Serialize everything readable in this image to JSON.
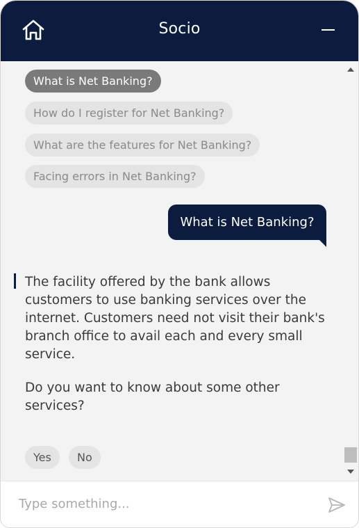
{
  "header": {
    "title": "Socio",
    "home_icon": "home-icon",
    "minimize_icon": "minimize-icon"
  },
  "chat": {
    "suggestions": [
      {
        "label": "What is Net Banking?",
        "state": "selected"
      },
      {
        "label": "How do I register for Net Banking?",
        "state": "option"
      },
      {
        "label": "What are the features for Net Banking?",
        "state": "option"
      },
      {
        "label": "Facing errors in Net Banking?",
        "state": "option"
      }
    ],
    "user_message": "What is Net Banking?",
    "bot_message": "The facility offered by the bank allows customers to use banking services over the internet. Customers need not visit their bank's branch office to avail each and every small service.",
    "bot_question": "Do you want to know about some other services?",
    "quick_replies": [
      "Yes",
      "No"
    ]
  },
  "input": {
    "placeholder": "Type something...",
    "value": ""
  },
  "colors": {
    "header_bg": "#0c1c3e",
    "chat_bg": "#f3f3f3",
    "selected_chip": "#7a7a7a",
    "chip_bg": "#e4e4e4"
  }
}
